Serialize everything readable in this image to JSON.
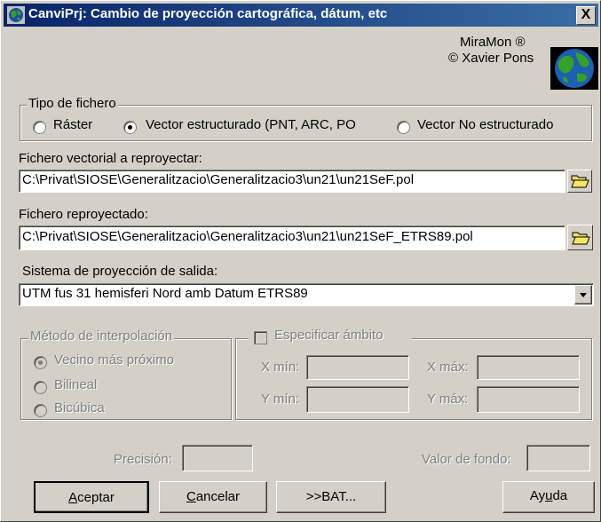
{
  "window": {
    "title": "CanviPrj: Cambio de proyección cartográfica, dátum, etc",
    "close": "X"
  },
  "credits": {
    "line1": "MiraMon ®",
    "line2": "© Xavier Pons"
  },
  "tipo": {
    "legend": "Tipo de fichero",
    "options": [
      "Ráster",
      "Vector estructurado (PNT, ARC, PO",
      "Vector No estructurado"
    ],
    "selected_index": 1
  },
  "input_file": {
    "label": "Fichero vectorial a reproyectar:",
    "value": "C:\\Privat\\SIOSE\\Generalitzacio\\Generalitzacio3\\un21\\un21SeF.pol"
  },
  "output_file": {
    "label": "Fichero reproyectado:",
    "value": "C:\\Privat\\SIOSE\\Generalitzacio\\Generalitzacio3\\un21\\un21SeF_ETRS89.pol"
  },
  "sistema": {
    "label": "Sistema de proyección de salida:",
    "value": "UTM fus 31 hemisferi Nord amb Datum ETRS89"
  },
  "interpolacion": {
    "legend": "Método de interpolación",
    "options": [
      "Vecino más próximo",
      "Bilineal",
      "Bicúbica"
    ],
    "selected_index": 0
  },
  "ambito": {
    "legend": "Especificar ámbito",
    "xmin": "X mín:",
    "xmax": "X máx:",
    "ymin": "Y mín:",
    "ymax": "Y máx:"
  },
  "precision": {
    "label": "Precisión:"
  },
  "fondo": {
    "label": "Valor de fondo:"
  },
  "buttons": {
    "aceptar_u": "A",
    "aceptar_rest": "ceptar",
    "cancelar_u": "C",
    "cancelar_rest": "ancelar",
    "bat": ">>BAT...",
    "ayuda_pre": "Ay",
    "ayuda_u": "u",
    "ayuda_rest": "da"
  },
  "icons": [
    "app-globe-icon",
    "miramon-globe-logo",
    "folder-open-icon",
    "dropdown-arrow-icon"
  ]
}
